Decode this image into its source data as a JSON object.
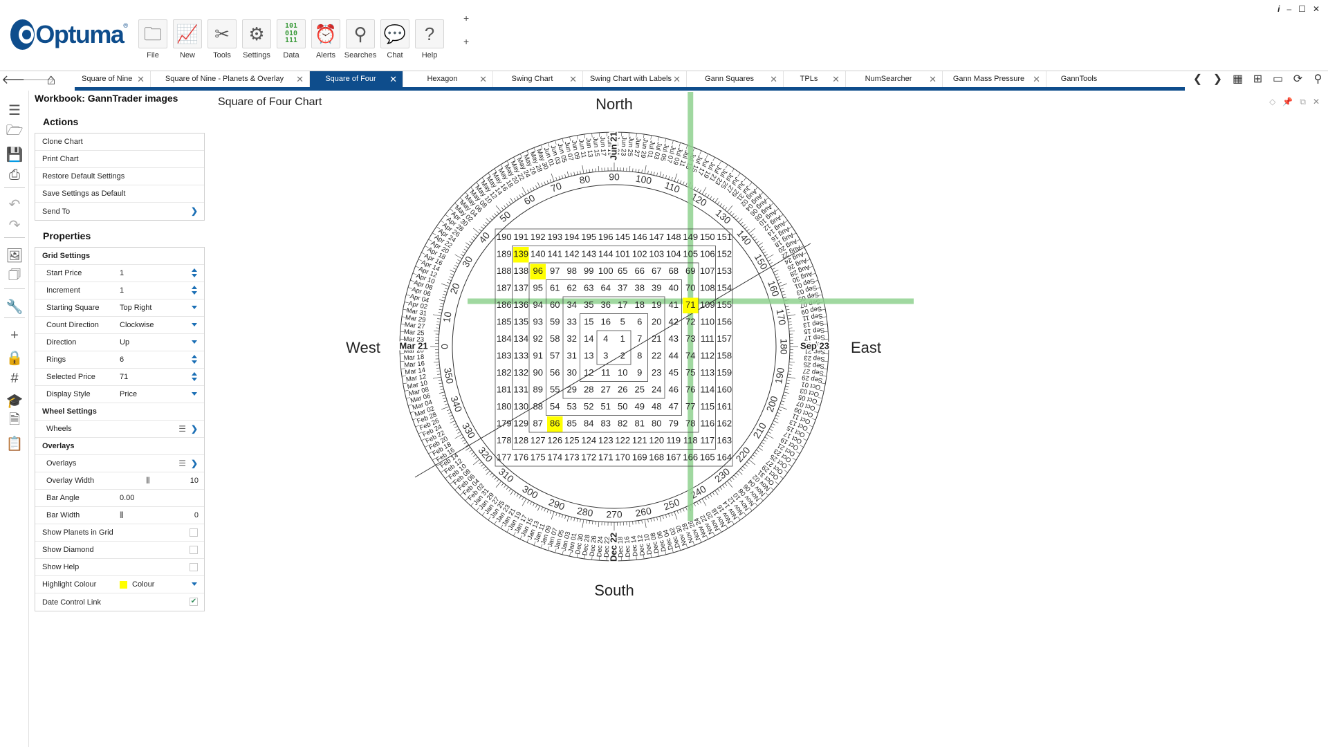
{
  "window": {
    "info": "i",
    "minimize": "–",
    "maximize": "☐",
    "close": "✕"
  },
  "logo": {
    "text": "Optuma",
    "tm": "®"
  },
  "ribbon": [
    {
      "label": "File",
      "icon": "folder-icon",
      "glyph": "🗀"
    },
    {
      "label": "New",
      "icon": "new-chart-icon",
      "glyph": "📈"
    },
    {
      "label": "Tools",
      "icon": "tools-icon",
      "glyph": "✂"
    },
    {
      "label": "Settings",
      "icon": "settings-icon",
      "glyph": "⚙"
    },
    {
      "label": "Data",
      "icon": "data-icon",
      "glyph": "101\n010\n111"
    },
    {
      "label": "Alerts",
      "icon": "alarm-clock-icon",
      "glyph": "⏰"
    },
    {
      "label": "Searches",
      "icon": "search-icon",
      "glyph": "⚲"
    },
    {
      "label": "Chat",
      "icon": "chat-icon",
      "glyph": "💬"
    },
    {
      "label": "Help",
      "icon": "help-icon",
      "glyph": "?"
    }
  ],
  "ribbon_plus": [
    "+",
    "+"
  ],
  "nav": {
    "back": "🡐",
    "forward": "🡒",
    "home": "⌂"
  },
  "tabs": [
    {
      "label": "Square of Nine",
      "active": false
    },
    {
      "label": "Square of Nine - Planets & Overlay",
      "active": false
    },
    {
      "label": "Square of Four",
      "active": true
    },
    {
      "label": "Hexagon",
      "active": false
    },
    {
      "label": "Swing Chart",
      "active": false
    },
    {
      "label": "Swing Chart with Labels",
      "active": false
    },
    {
      "label": "Gann Squares",
      "active": false
    },
    {
      "label": "TPLs",
      "active": false
    },
    {
      "label": "NumSearcher",
      "active": false
    },
    {
      "label": "Gann Mass Pressure",
      "active": false
    },
    {
      "label": "GannTools",
      "active": false
    }
  ],
  "tab_close": "✕",
  "tab_tools": [
    {
      "name": "scroll-left-icon",
      "glyph": "❮"
    },
    {
      "name": "scroll-right-icon",
      "glyph": "❯"
    },
    {
      "name": "layout-icon",
      "glyph": "▦"
    },
    {
      "name": "grid-layout-icon",
      "glyph": "⊞"
    },
    {
      "name": "window-icon",
      "glyph": "▭"
    },
    {
      "name": "refresh-icon",
      "glyph": "⟳"
    },
    {
      "name": "search-icon",
      "glyph": "⚲"
    }
  ],
  "toolstrip": [
    {
      "name": "workbook-icon",
      "glyph": "☰"
    },
    {
      "name": "open-icon",
      "glyph": "🗁"
    },
    {
      "name": "save-icon",
      "glyph": "💾"
    },
    {
      "name": "print-icon",
      "glyph": "⎙"
    },
    {
      "name": "undo-icon",
      "glyph": "↶"
    },
    {
      "name": "redo-icon",
      "glyph": "↷"
    },
    {
      "name": "picture-icon",
      "glyph": "🖼"
    },
    {
      "name": "pictures-icon",
      "glyph": "🗇"
    },
    {
      "name": "wrench-icon",
      "glyph": "🔧"
    },
    {
      "name": "crosshair-icon",
      "glyph": "+"
    },
    {
      "name": "lock-icon",
      "glyph": "🔒"
    },
    {
      "name": "grid-icon",
      "glyph": "#"
    },
    {
      "name": "scholar-icon",
      "glyph": "🎓"
    },
    {
      "name": "document-icon",
      "glyph": "🗎"
    },
    {
      "name": "clipboard-icon",
      "glyph": "📋"
    }
  ],
  "panel": {
    "workbook_title": "Workbook: GannTrader images",
    "actions_title": "Actions",
    "actions": [
      "Clone Chart",
      "Print Chart",
      "Restore Default Settings",
      "Save Settings as Default",
      "Send To"
    ],
    "properties_title": "Properties",
    "grid_settings": "Grid Settings",
    "start_price": {
      "label": "Start Price",
      "value": "1"
    },
    "increment": {
      "label": "Increment",
      "value": "1"
    },
    "starting_square": {
      "label": "Starting Square",
      "value": "Top Right"
    },
    "count_direction": {
      "label": "Count Direction",
      "value": "Clockwise"
    },
    "direction": {
      "label": "Direction",
      "value": "Up"
    },
    "rings": {
      "label": "Rings",
      "value": "6"
    },
    "selected_price": {
      "label": "Selected Price",
      "value": "71"
    },
    "display_style": {
      "label": "Display Style",
      "value": "Price"
    },
    "wheel_settings": "Wheel Settings",
    "wheels": {
      "label": "Wheels"
    },
    "overlays_head": "Overlays",
    "overlays": {
      "label": "Overlays"
    },
    "overlay_width": {
      "label": "Overlay Width",
      "value": "10"
    },
    "bar_angle": {
      "label": "Bar Angle",
      "value": "0.00"
    },
    "bar_width": {
      "label": "Bar Width",
      "value": "0"
    },
    "show_planets": {
      "label": "Show Planets in Grid",
      "checked": false
    },
    "show_diamond": {
      "label": "Show Diamond",
      "checked": false
    },
    "show_help": {
      "label": "Show Help",
      "checked": false
    },
    "highlight_colour": {
      "label": "Highlight Colour",
      "value": "Colour",
      "color": "#ffff00"
    },
    "date_control": {
      "label": "Date Control Link",
      "checked": true
    }
  },
  "chart": {
    "title": "Square of Four Chart",
    "north": "North",
    "south": "South",
    "east": "East",
    "west": "West",
    "grid": [
      [
        "190",
        "191",
        "192",
        "193",
        "194",
        "195",
        "196",
        "145",
        "146",
        "147",
        "148",
        "149",
        "150",
        "151"
      ],
      [
        "189",
        "139",
        "140",
        "141",
        "142",
        "143",
        "144",
        "101",
        "102",
        "103",
        "104",
        "105",
        "106",
        "152"
      ],
      [
        "188",
        "138",
        "96",
        "97",
        "98",
        "99",
        "100",
        "65",
        "66",
        "67",
        "68",
        "69",
        "107",
        "153"
      ],
      [
        "187",
        "137",
        "95",
        "61",
        "62",
        "63",
        "64",
        "37",
        "38",
        "39",
        "40",
        "70",
        "108",
        "154"
      ],
      [
        "186",
        "136",
        "94",
        "60",
        "34",
        "35",
        "36",
        "17",
        "18",
        "19",
        "41",
        "71",
        "109",
        "155"
      ],
      [
        "185",
        "135",
        "93",
        "59",
        "33",
        "15",
        "16",
        "5",
        "6",
        "20",
        "42",
        "72",
        "110",
        "156"
      ],
      [
        "184",
        "134",
        "92",
        "58",
        "32",
        "14",
        "4",
        "1",
        "7",
        "21",
        "43",
        "73",
        "111",
        "157"
      ],
      [
        "183",
        "133",
        "91",
        "57",
        "31",
        "13",
        "3",
        "2",
        "8",
        "22",
        "44",
        "74",
        "112",
        "158"
      ],
      [
        "182",
        "132",
        "90",
        "56",
        "30",
        "12",
        "11",
        "10",
        "9",
        "23",
        "45",
        "75",
        "113",
        "159"
      ],
      [
        "181",
        "131",
        "89",
        "55",
        "29",
        "28",
        "27",
        "26",
        "25",
        "24",
        "46",
        "76",
        "114",
        "160"
      ],
      [
        "180",
        "130",
        "88",
        "54",
        "53",
        "52",
        "51",
        "50",
        "49",
        "48",
        "47",
        "77",
        "115",
        "161"
      ],
      [
        "179",
        "129",
        "87",
        "86",
        "85",
        "84",
        "83",
        "82",
        "81",
        "80",
        "79",
        "78",
        "116",
        "162"
      ],
      [
        "178",
        "128",
        "127",
        "126",
        "125",
        "124",
        "123",
        "122",
        "121",
        "120",
        "119",
        "118",
        "117",
        "163"
      ],
      [
        "177",
        "176",
        "175",
        "174",
        "173",
        "172",
        "171",
        "170",
        "169",
        "168",
        "167",
        "166",
        "165",
        "164"
      ]
    ],
    "highlighted": [
      "139",
      "96",
      "71",
      "86"
    ],
    "highlight_color": "#ffff00",
    "overlay_color": "#8fd18f",
    "degree_labels": [
      "0",
      "10",
      "20",
      "30",
      "40",
      "50",
      "60",
      "70",
      "80",
      "90",
      "100",
      "110",
      "120",
      "130",
      "140",
      "150",
      "160",
      "170",
      "180",
      "190",
      "200",
      "210",
      "220",
      "230",
      "240",
      "250",
      "260",
      "270",
      "280",
      "290",
      "300",
      "310",
      "320",
      "330",
      "340",
      "350"
    ],
    "cardinal_dates": [
      "Mar 21",
      "Jun 21",
      "Sep 23",
      "Dec 22"
    ],
    "month_names": [
      "Jan",
      "Feb",
      "Mar",
      "Apr",
      "May",
      "Jun",
      "Jul",
      "Aug",
      "Sep",
      "Oct",
      "Nov",
      "Dec"
    ]
  }
}
